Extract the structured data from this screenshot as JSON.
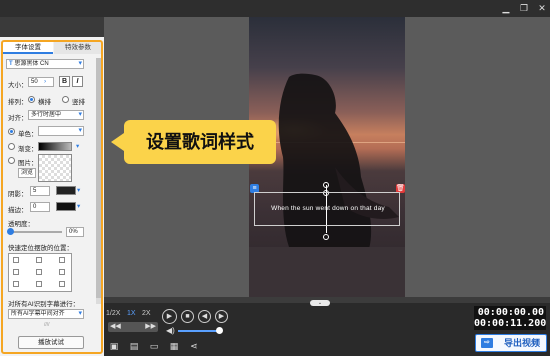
{
  "window": {
    "minimize_icon": "minimize-icon",
    "maximize_icon": "restore-icon",
    "close_icon": "close-icon"
  },
  "panel": {
    "tabs": [
      "字体设置",
      "特效参数"
    ],
    "font_family": "思源黑体 CN",
    "size_label": "大小：",
    "size_value": "50",
    "bold_label": "B",
    "italic_label": "I",
    "layout_label": "排列：",
    "layout_options": [
      "横排",
      "竖排"
    ],
    "align_label": "对齐：",
    "align_value": "多行时居中",
    "fill_options": [
      "单色：",
      "渐变：",
      "图片："
    ],
    "browse_label": "浏览",
    "shadow_label": "阴影：",
    "shadow_value": "5",
    "stroke_label": "描边：",
    "stroke_value": "0",
    "opacity_label": "透明度：",
    "opacity_value": "0%",
    "quick_pos_label": "快速定位摆放的位置：",
    "ai_label": "对所有AI识别字幕进行：",
    "ai_value": "所有AI字幕中间对齐",
    "play_preview": "播放试试",
    "colors": {
      "accent": "#2f7de1",
      "frame": "#f5a623"
    }
  },
  "stage": {
    "lyric_text": "When the sun went down on that day",
    "callout_text": "设置歌词样式",
    "callout_color": "#fbd34a"
  },
  "timeline": {
    "speeds": [
      "1/2X",
      "1X",
      "2X"
    ],
    "current_speed": "1X",
    "time_current": "00:00:00.00",
    "time_total": "00:00:11.200",
    "export_label": "导出视频",
    "volume": 0.9
  }
}
